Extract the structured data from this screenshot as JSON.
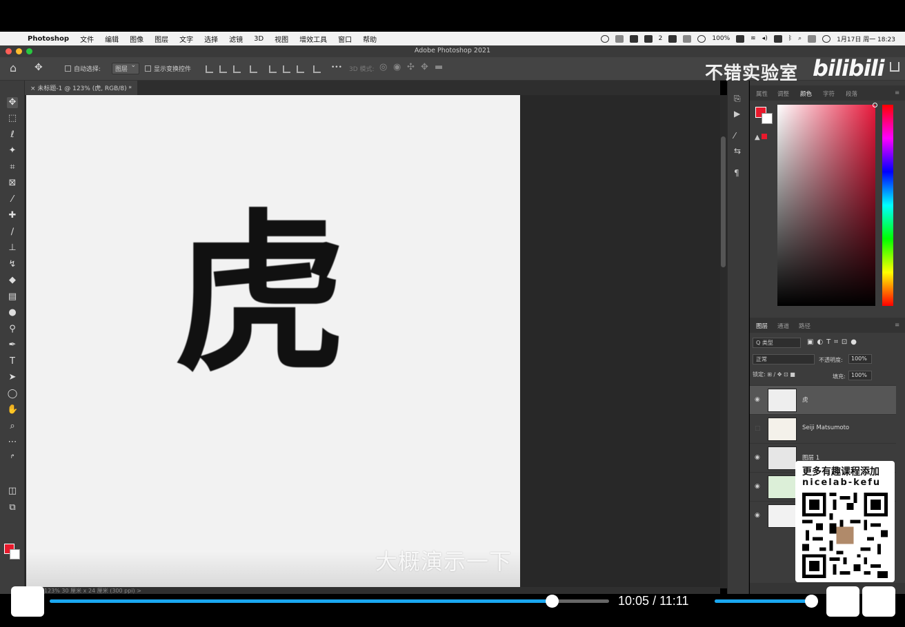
{
  "menubar": {
    "items": [
      "Photoshop",
      "文件",
      "编辑",
      "图像",
      "图层",
      "文字",
      "选择",
      "滤镜",
      "3D",
      "视图",
      "增效工具",
      "窗口",
      "帮助"
    ],
    "status_count": "2",
    "battery": "100%",
    "clock": "1月17日 周一 18:23"
  },
  "titlebar": {
    "title": "Adobe Photoshop 2021"
  },
  "options": {
    "auto_select": "自动选择:",
    "layer_select": "图层",
    "show_transform": "显示变换控件",
    "more": "•••",
    "mode_3d": "3D 模式:"
  },
  "overlay": {
    "brand": "不错实验室",
    "logo": "bilibili",
    "subtitle": "大概演示一下"
  },
  "document": {
    "tab_title": "未标题-1 @ 123% (虎, RGB/8) *",
    "glyph": "虎",
    "status": "123%   30 厘米 x 24 厘米 (300 ppi)   >"
  },
  "panels": {
    "top_tabs": [
      "属性",
      "调整",
      "颜色",
      "字符",
      "段落"
    ],
    "top_active": "颜色",
    "layer_tabs": [
      "图层",
      "通道",
      "路径"
    ],
    "layer_active": "图层",
    "filter": "Q 类型",
    "blend_mode": "正常",
    "opacity_label": "不透明度:",
    "opacity": "100%",
    "lock_label": "锁定:",
    "fill_label": "填充:",
    "fill": "100%"
  },
  "layers": [
    {
      "name": "虎",
      "visible": true,
      "selected": true
    },
    {
      "name": "Seiji Matsumoto",
      "visible": false,
      "selected": false
    },
    {
      "name": "图层 1",
      "visible": true,
      "selected": false
    },
    {
      "name": "",
      "visible": true,
      "selected": false
    },
    {
      "name": "",
      "visible": true,
      "selected": false
    }
  ],
  "qr_overlay": {
    "line1": "更多有趣课程添加",
    "line2": "nicelab-kefu"
  },
  "player": {
    "current_time": "10:05",
    "separator": "/",
    "total_time": "11:11",
    "progress": 0.899,
    "volume": 1.0
  },
  "colors": {
    "foreground": "#e8192c",
    "background": "#ffffff",
    "accent": "#1aa7f0"
  }
}
